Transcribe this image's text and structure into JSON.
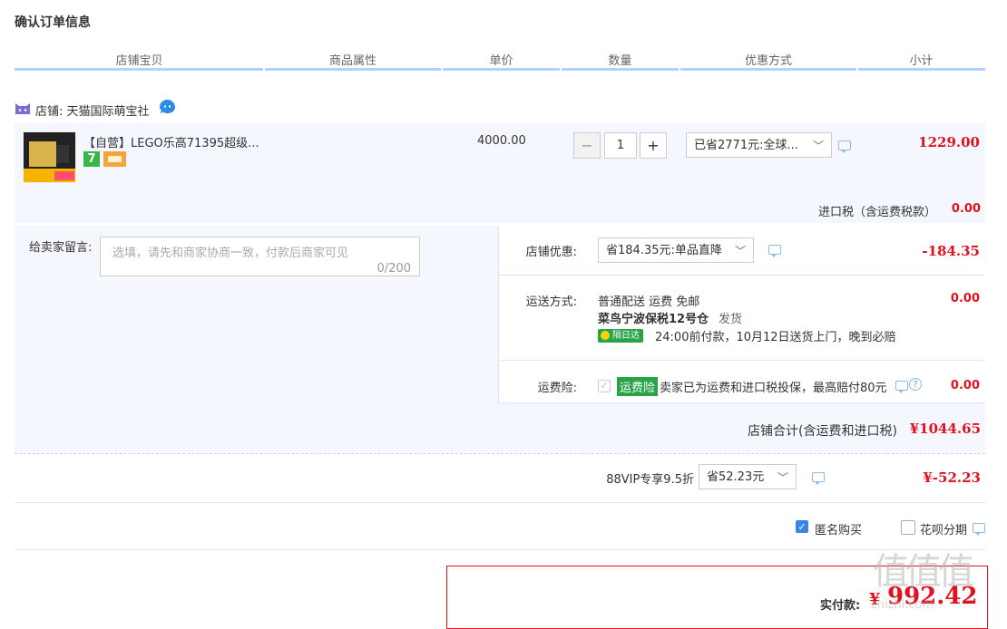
{
  "page_title": "确认订单信息",
  "columns": [
    "店铺宝贝",
    "商品属性",
    "单价",
    "数量",
    "优惠方式",
    "小计"
  ],
  "shop": {
    "label": "店铺: 天猫国际萌宝社"
  },
  "item": {
    "name": "【自营】LEGO乐高71395超级...",
    "badge_7": "7",
    "unit_price": "4000.00",
    "quantity": "1",
    "qty_minus": "−",
    "qty_plus": "+",
    "discount_select": "已省2771元:全球...",
    "subtotal": "1229.00"
  },
  "import_tax": {
    "label": "进口税（含运费税款）",
    "value": "0.00"
  },
  "message": {
    "label": "给卖家留言:",
    "placeholder": "选填，请先和商家协商一致，付款后商家可见",
    "counter": "0/200"
  },
  "shop_discount": {
    "label": "店铺优惠:",
    "select": "省184.35元:单品直降",
    "value": "-184.35"
  },
  "shipping": {
    "label": "运送方式:",
    "method": "普通配送 运费 免邮",
    "warehouse": "菜鸟宁波保税12号仓",
    "warehouse_suffix": "发货",
    "tag": "隔日达",
    "note": "24:00前付款，10月12日送货上门，晚到必赔",
    "value": "0.00"
  },
  "insurance": {
    "label": "运费险:",
    "tag": "运费险",
    "text": "卖家已为运费和进口税投保，最高赔付80元",
    "value": "0.00"
  },
  "shop_total": {
    "label": "店铺合计(含运费和进口税)",
    "value": "¥1044.65"
  },
  "vip": {
    "label": "88VIP专享9.5折",
    "select": "省52.23元",
    "value": "¥-52.23"
  },
  "options": {
    "anonymous": "匿名购买",
    "huabei": "花呗分期"
  },
  "payment": {
    "label": "实付款:",
    "currency": "¥",
    "amount": "992.42"
  },
  "watermark": {
    "text": "值值值",
    "sub": "zhizhi.com"
  },
  "colors": {
    "accent": "#e3101e",
    "header_line": "#b2d1ff",
    "panel_bg": "#f4f8fe",
    "check_blue": "#3a84e6",
    "green_tag": "#27a348"
  },
  "icons": [
    "shop-cat-icon",
    "wangwang-icon",
    "chat-icon",
    "chevron-down-icon",
    "check-icon",
    "help-icon"
  ]
}
